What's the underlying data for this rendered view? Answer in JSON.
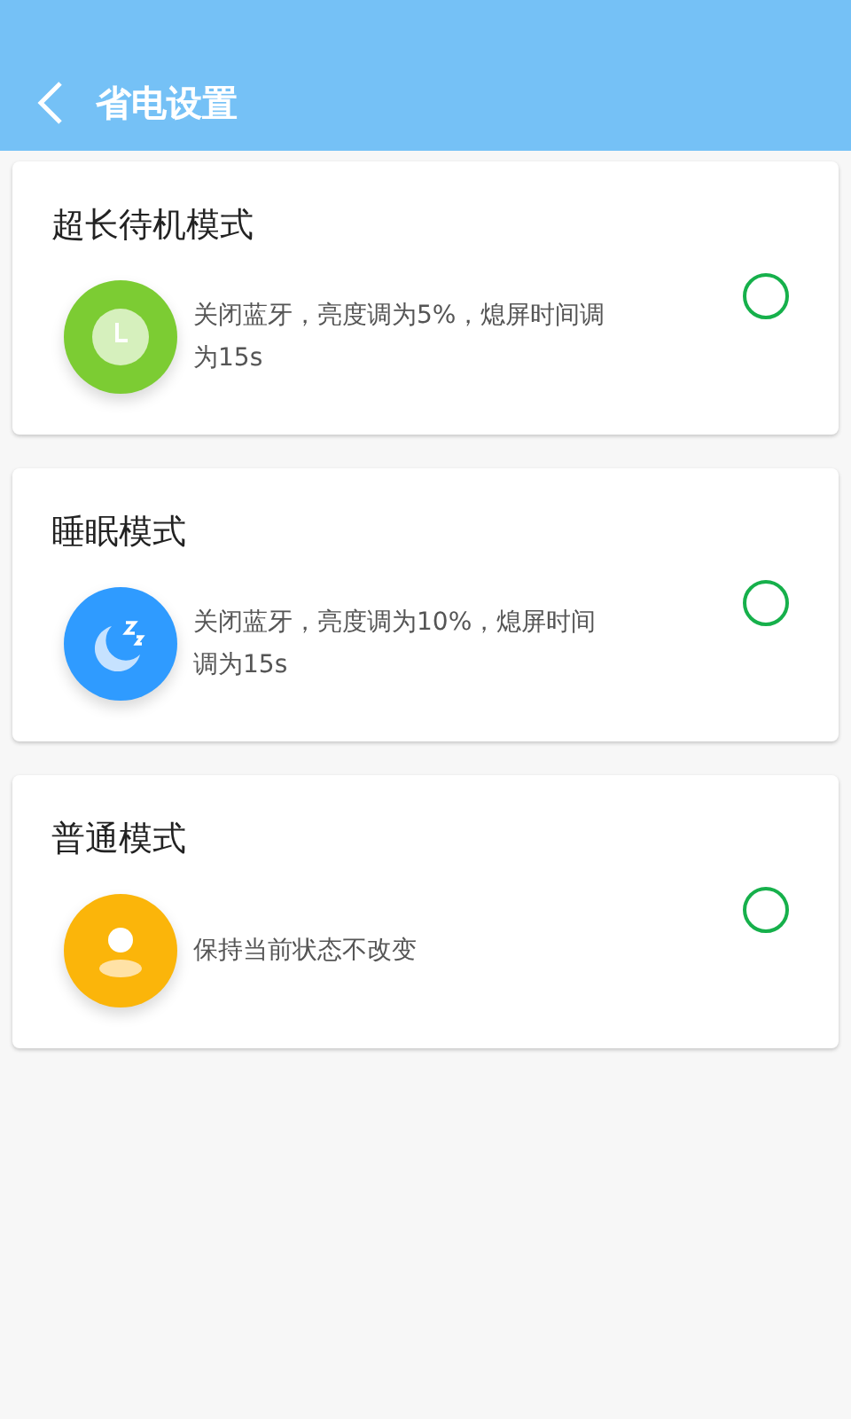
{
  "header": {
    "title": "省电设置"
  },
  "modes": [
    {
      "title": "超长待机模式",
      "kind": "clock",
      "color": "#7ccc33",
      "description": "关闭蓝牙，亮度调为5%，熄屏时间调为15s",
      "selected": false
    },
    {
      "title": "睡眠模式",
      "kind": "sleep",
      "color": "#2f9bff",
      "description": "关闭蓝牙，亮度调为10%，熄屏时间调为15s",
      "selected": false
    },
    {
      "title": "普通模式",
      "kind": "person",
      "color": "#fbb50a",
      "description": "保持当前状态不改变",
      "selected": false
    }
  ]
}
